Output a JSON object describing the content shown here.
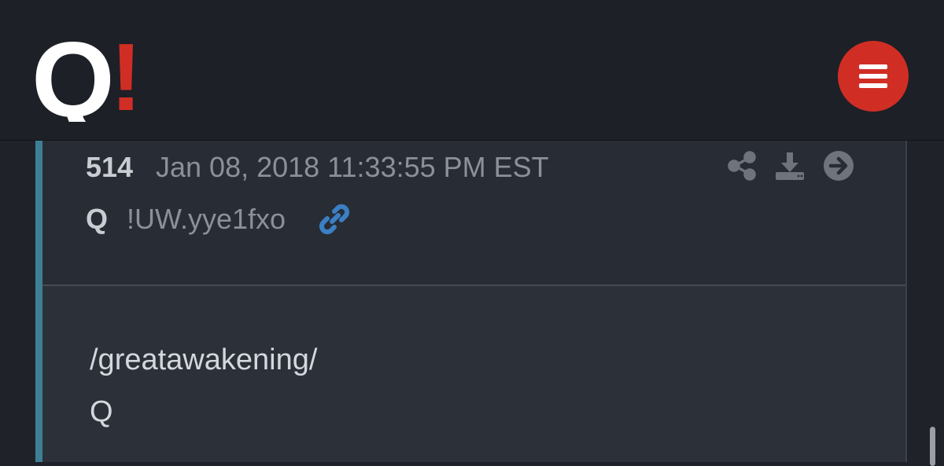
{
  "header": {
    "logo": {
      "letter": "Q",
      "mark": "!",
      "colors": {
        "letter": "#ffffff",
        "mark": "#d02e25"
      }
    },
    "menu_icon": "hamburger-icon",
    "menu_color": "#d02e25"
  },
  "post": {
    "number": "514",
    "date": "Jan 08, 2018 11:33:55 PM EST",
    "author": "Q",
    "tripcode": "!UW.yye1fxo",
    "link_icon": "link-icon",
    "link_color": "#3b7fc4",
    "accent_color": "#3e7f96",
    "actions": [
      "share-icon",
      "download-icon",
      "arrow-right-circle-icon"
    ],
    "body": [
      "/greatawakening/",
      "Q"
    ]
  }
}
